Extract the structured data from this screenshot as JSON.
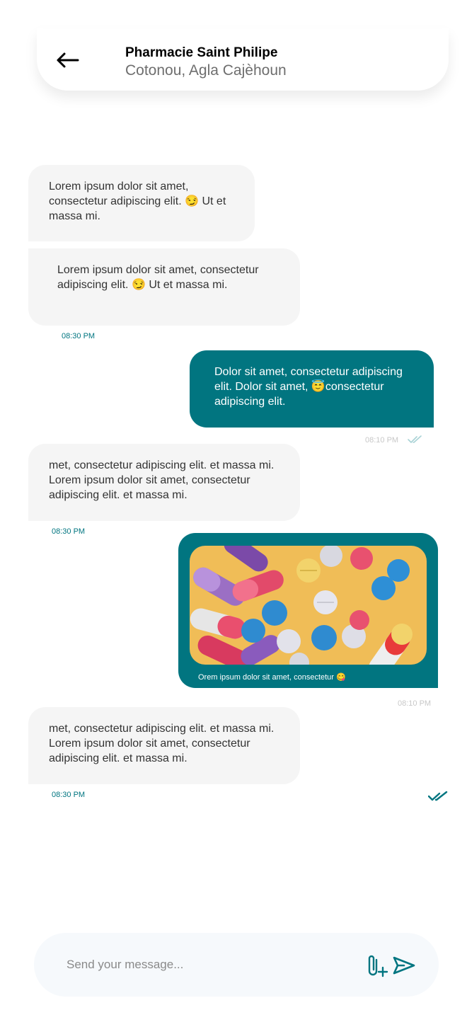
{
  "header": {
    "title": "Pharmacie Saint Philipe",
    "subtitle": "Cotonou, Agla Cajèhoun",
    "back_icon": "arrow-left-icon"
  },
  "messages": [
    {
      "direction": "in",
      "text": "Lorem ipsum dolor sit amet, consectetur adipiscing elit. 😏 Ut et massa mi."
    },
    {
      "direction": "in",
      "text": "Lorem ipsum dolor sit amet, consectetur adipiscing elit. 😏 Ut et massa mi.",
      "time": "08:30 PM"
    },
    {
      "direction": "out",
      "text": "Dolor sit amet, consectetur adipiscing elit. Dolor sit amet, 😇consectetur adipiscing elit.",
      "time": "08:10 PM",
      "status_icon": "double-check-icon"
    },
    {
      "direction": "in",
      "text": "met, consectetur adipiscing elit. et massa mi. Lorem ipsum dolor sit amet, consectetur adipiscing elit. et massa mi.",
      "time": "08:30 PM"
    },
    {
      "direction": "out",
      "type": "image",
      "image": "pills-photo",
      "caption": "Orem ipsum dolor sit amet, consectetur 😋",
      "time": "08:10 PM"
    },
    {
      "direction": "in",
      "text": "met, consectetur adipiscing elit. et massa mi. Lorem ipsum dolor sit amet, consectetur adipiscing elit. et massa mi.",
      "time": "08:30 PM",
      "status_icon": "double-check-icon"
    }
  ],
  "composer": {
    "placeholder": "Send your message...",
    "attach_icon": "paperclip-plus-icon",
    "send_icon": "send-icon"
  },
  "colors": {
    "accent": "#017580",
    "incoming_bubble": "#f5f5f5",
    "composer_bg": "#f6f9fc"
  }
}
